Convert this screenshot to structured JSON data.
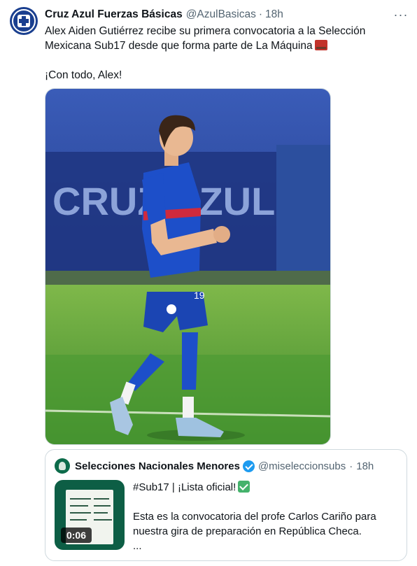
{
  "tweet": {
    "author_name": "Cruz Azul Fuerzas Básicas",
    "author_handle": "@AzulBasicas",
    "separator": "·",
    "time": "18h",
    "more_label": "···",
    "text_line_1": "Alex Aiden Gutiérrez recibe su primera convocatoria a la Selección Mexicana Sub17 desde que forma parte de La Máquina",
    "text_line_2": "¡Con todo, Alex!",
    "avatar_icon": "cruz-azul-crest-icon",
    "emoji_icon": "locomotive-emoji-icon",
    "photo_banner_text": "CRUZ AZUL",
    "photo_shorts_number": "19"
  },
  "quoted": {
    "author_name": "Selecciones Nacionales Menores",
    "author_handle": "@miseleccionsubs",
    "separator": "·",
    "time": "18h",
    "verified_icon": "verified-badge-icon",
    "line_1": "#Sub17 | ¡Lista oficial!",
    "line_2": "Esta es la convocatoria del profe Carlos Cariño para nuestra gira de preparación en República Checa.",
    "line_3": "...",
    "video_duration": "0:06",
    "check_icon": "check-mark-emoji-icon"
  },
  "colors": {
    "text": "#0f1419",
    "secondary": "#536471",
    "border": "#cfd9de",
    "verified": "#1d9bf0",
    "jersey_blue": "#1d4fc9"
  }
}
